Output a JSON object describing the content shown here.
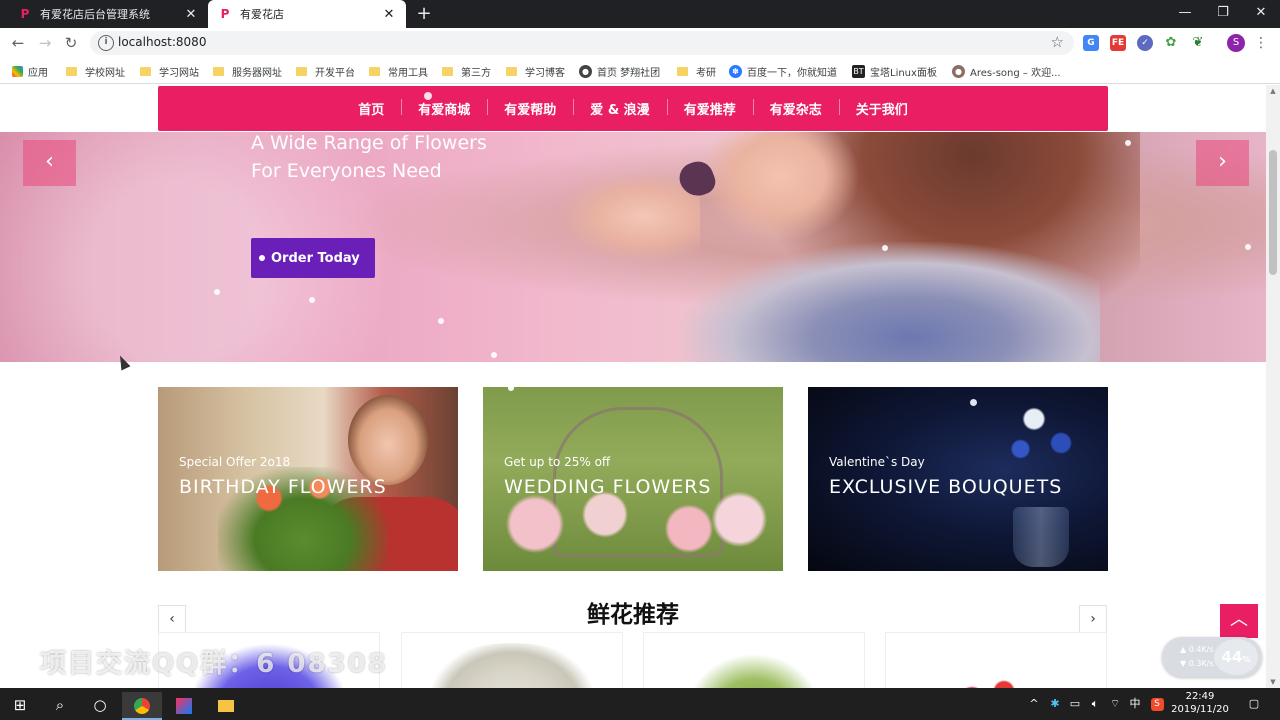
{
  "browser": {
    "tabs": [
      {
        "title": "有爱花店后台管理系统",
        "active": false
      },
      {
        "title": "有爱花店",
        "active": true
      }
    ],
    "url": "localhost:8080",
    "profile_initial": "S",
    "bookmarks": [
      {
        "label": "应用",
        "type": "apps-icon"
      },
      {
        "label": "学校网址",
        "type": "folder-icon"
      },
      {
        "label": "学习网站",
        "type": "folder-icon"
      },
      {
        "label": "服务器网址",
        "type": "folder-icon"
      },
      {
        "label": "开发平台",
        "type": "folder-icon"
      },
      {
        "label": "常用工具",
        "type": "folder-icon"
      },
      {
        "label": "第三方",
        "type": "folder-icon"
      },
      {
        "label": "学习博客",
        "type": "folder-icon"
      },
      {
        "label": "首页 梦翔社团",
        "type": "site-icon"
      },
      {
        "label": "考研",
        "type": "folder-icon"
      },
      {
        "label": "百度一下，你就知道",
        "type": "baidu-icon"
      },
      {
        "label": "宝塔Linux面板",
        "type": "bt-icon"
      },
      {
        "label": "Ares-song – 欢迎...",
        "type": "site-icon"
      }
    ]
  },
  "nav": {
    "items": [
      "首页",
      "有爱商城",
      "有爱帮助",
      "爱 & 浪漫",
      "有爱推荐",
      "有爱杂志",
      "关于我们"
    ]
  },
  "hero": {
    "line1": "A Wide Range of Flowers",
    "line2": "For Everyones Need",
    "button": "Order Today",
    "prev_arrow": "‹",
    "next_arrow": "›"
  },
  "promos": [
    {
      "overline": "Special Offer 2o18",
      "heading": "BIRTHDAY FLOWERS"
    },
    {
      "overline": "Get up to 25% off",
      "heading": "WEDDING FLOWERS"
    },
    {
      "overline": "Valentine`s Day",
      "heading": "EXCLUSIVE BOUQUETS"
    }
  ],
  "recommend": {
    "title": "鲜花推荐",
    "prev": "‹",
    "next": "›"
  },
  "overlay": {
    "watermark": "项目交流QQ群：6    08308",
    "back_to_top": "︿"
  },
  "netwidget": {
    "up": "0.4",
    "down": "0.3",
    "unit": "K/s",
    "percent": "44"
  },
  "taskbar": {
    "ime": "中",
    "time": "22:49",
    "date": "2019/11/20"
  },
  "colors": {
    "brand_pink": "#e91e63",
    "order_purple": "#6a1fb8"
  }
}
